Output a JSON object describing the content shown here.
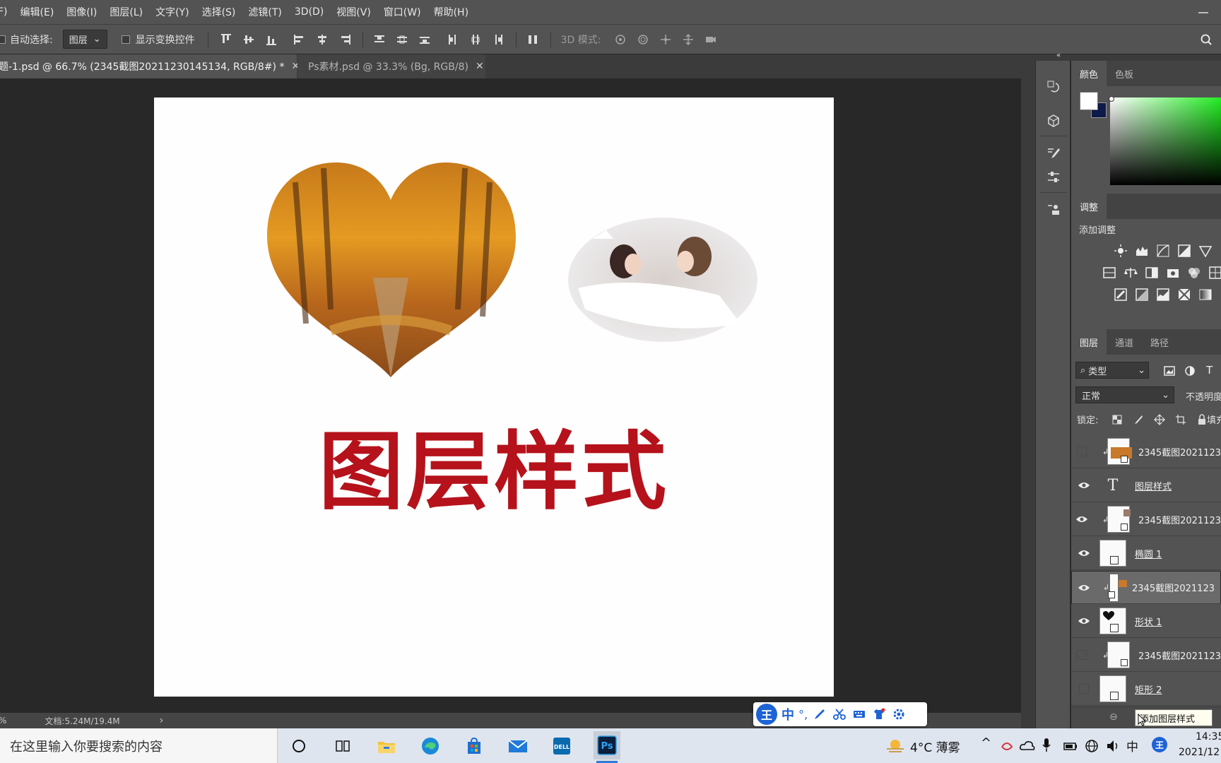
{
  "menu": {
    "items": [
      "F)",
      "编辑(E)",
      "图像(I)",
      "图层(L)",
      "文字(Y)",
      "选择(S)",
      "滤镜(T)",
      "3D(D)",
      "视图(V)",
      "窗口(W)",
      "帮助(H)"
    ]
  },
  "options": {
    "auto_select_label": "自动选择:",
    "auto_select_value": "图层",
    "show_transform_label": "显示变换控件",
    "mode_3d_label": "3D 模式:"
  },
  "tabs": [
    {
      "label": "题-1.psd @ 66.7% (2345截图20211230145134, RGB/8#) *",
      "close": "✕"
    },
    {
      "label": "Ps素材.psd @ 33.3% (Bg, RGB/8)",
      "close": "✕"
    }
  ],
  "canvas": {
    "title_text": "图层样式",
    "title_color": "#b5121b"
  },
  "status": {
    "zoom_frag": "%",
    "doc_info": "文档:5.24M/19.4M",
    "arrow": "›"
  },
  "color_panel": {
    "tabs": [
      "颜色",
      "色板"
    ],
    "fg_color": "#ffffff",
    "bg_color": "#0d1a4a"
  },
  "adjust_panel": {
    "tab": "调整",
    "add_label": "添加调整"
  },
  "layers_panel": {
    "tabs": [
      "图层",
      "通道",
      "路径"
    ],
    "filter_label": "类型",
    "blend_mode": "正常",
    "opacity_label": "不透明度",
    "lock_label": "锁定:",
    "fill_label": "填充",
    "layers": [
      {
        "name": "2345截图2021123",
        "visible": false,
        "clipped": true,
        "underline": false,
        "selected": false
      },
      {
        "name": "图层样式",
        "visible": true,
        "clipped": false,
        "underline": true,
        "selected": false
      },
      {
        "name": "2345截图2021123",
        "visible": true,
        "clipped": true,
        "underline": false,
        "selected": false
      },
      {
        "name": "椭圆 1",
        "visible": true,
        "clipped": false,
        "underline": true,
        "selected": false
      },
      {
        "name": "2345截图2021123",
        "visible": true,
        "clipped": true,
        "underline": false,
        "selected": true
      },
      {
        "name": "形状 1",
        "visible": true,
        "clipped": false,
        "underline": true,
        "selected": false
      },
      {
        "name": "2345截图2021123",
        "visible": false,
        "clipped": true,
        "underline": false,
        "selected": false
      },
      {
        "name": "矩形 2",
        "visible": false,
        "clipped": false,
        "underline": true,
        "selected": false
      }
    ],
    "tooltip": "添加图层样式"
  },
  "ime": {
    "lang": "中",
    "punct": "°,"
  },
  "taskbar": {
    "search_placeholder": "在这里输入你要搜索的内容",
    "weather": "4°C 薄雾",
    "input_lang": "中",
    "time": "14:35",
    "date": "2021/12"
  }
}
